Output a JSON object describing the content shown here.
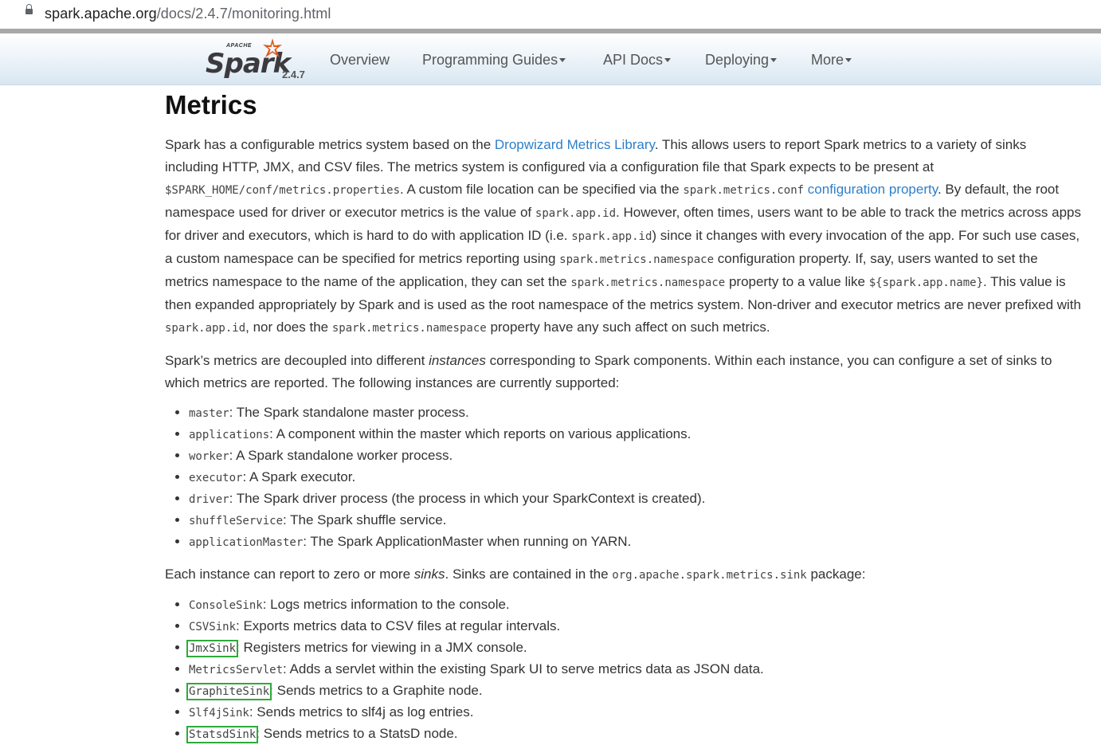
{
  "browser": {
    "url_host": "spark.apache.org",
    "url_path": "/docs/2.4.7/monitoring.html"
  },
  "navbar": {
    "logo_apache": "APACHE",
    "logo_word": "Spark",
    "version": "2.4.7",
    "items": [
      {
        "label": "Overview",
        "dropdown": false
      },
      {
        "label": "Programming Guides",
        "dropdown": true
      },
      {
        "label": "API Docs",
        "dropdown": true
      },
      {
        "label": "Deploying",
        "dropdown": true
      },
      {
        "label": "More",
        "dropdown": true
      }
    ]
  },
  "content": {
    "heading": "Metrics",
    "p1": {
      "t0": "Spark has a configurable metrics system based on the ",
      "link_dropwizard": "Dropwizard Metrics Library",
      "t1": ". This allows users to report Spark metrics to a variety of sinks including HTTP, JMX, and CSV files. The metrics system is configured via a configuration file that Spark expects to be present at ",
      "c_props": "$SPARK_HOME/conf/metrics.properties",
      "t2": ". A custom file location can be specified via the ",
      "c_conf": "spark.metrics.conf",
      "t3": " ",
      "link_config": "configuration property",
      "t4": ". By default, the root namespace used for driver or executor metrics is the value of ",
      "c_appid1": "spark.app.id",
      "t5": ". However, often times, users want to be able to track the metrics across apps for driver and executors, which is hard to do with application ID (i.e. ",
      "c_appid2": "spark.app.id",
      "t6": ") since it changes with every invocation of the app. For such use cases, a custom namespace can be specified for metrics reporting using ",
      "c_ns1": "spark.metrics.namespace",
      "t7": " configuration property. If, say, users wanted to set the metrics namespace to the name of the application, they can set the ",
      "c_ns2": "spark.metrics.namespace",
      "t8": " property to a value like ",
      "c_appname": "${spark.app.name}",
      "t9": ". This value is then expanded appropriately by Spark and is used as the root namespace of the metrics system. Non-driver and executor metrics are never prefixed with ",
      "c_appid3": "spark.app.id",
      "t10": ", nor does the ",
      "c_ns3": "spark.metrics.namespace",
      "t11": " property have any such affect on such metrics."
    },
    "p2": {
      "t0": "Spark’s metrics are decoupled into different ",
      "em": "instances",
      "t1": " corresponding to Spark components. Within each instance, you can configure a set of sinks to which metrics are reported. The following instances are currently supported:"
    },
    "instances": [
      {
        "code": "master",
        "desc": ": The Spark standalone master process."
      },
      {
        "code": "applications",
        "desc": ": A component within the master which reports on various applications."
      },
      {
        "code": "worker",
        "desc": ": A Spark standalone worker process."
      },
      {
        "code": "executor",
        "desc": ": A Spark executor."
      },
      {
        "code": "driver",
        "desc": ": The Spark driver process (the process in which your SparkContext is created)."
      },
      {
        "code": "shuffleService",
        "desc": ": The Spark shuffle service."
      },
      {
        "code": "applicationMaster",
        "desc": ": The Spark ApplicationMaster when running on YARN."
      }
    ],
    "p3": {
      "t0": "Each instance can report to zero or more ",
      "em": "sinks",
      "t1": ". Sinks are contained in the ",
      "code": "org.apache.spark.metrics.sink",
      "t2": " package:"
    },
    "sinks": [
      {
        "code": "ConsoleSink",
        "desc": ": Logs metrics information to the console.",
        "highlighted": false
      },
      {
        "code": "CSVSink",
        "desc": ": Exports metrics data to CSV files at regular intervals.",
        "highlighted": false
      },
      {
        "code": "JmxSink",
        "desc": ": Registers metrics for viewing in a JMX console.",
        "highlighted": true
      },
      {
        "code": "MetricsServlet",
        "desc": ": Adds a servlet within the existing Spark UI to serve metrics data as JSON data.",
        "highlighted": false
      },
      {
        "code": "GraphiteSink",
        "desc": ": Sends metrics to a Graphite node.",
        "highlighted": true
      },
      {
        "code": "Slf4jSink",
        "desc": ": Sends metrics to slf4j as log entries.",
        "highlighted": false
      },
      {
        "code": "StatsdSink",
        "desc": ": Sends metrics to a StatsD node.",
        "highlighted": true
      }
    ],
    "highlight_color": "#2eaa3a",
    "link_color": "#2d7fc9"
  }
}
